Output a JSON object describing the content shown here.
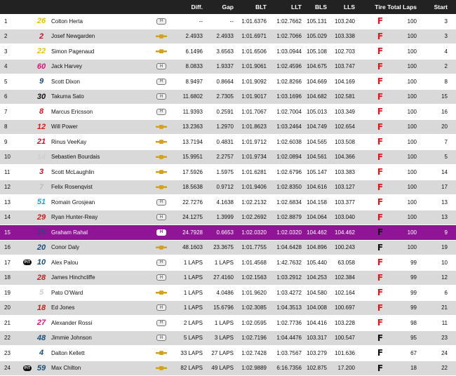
{
  "header": {
    "diff": "Diff.",
    "gap": "Gap",
    "blt": "BLT",
    "llt": "LLT",
    "bls": "BLS",
    "lls": "LLS",
    "tire": "Tire",
    "laps": "Total Laps",
    "start": "Start"
  },
  "colors": {
    "header_bg": "#222222",
    "row_even": "#d9d9d9",
    "highlight": "#8f1496",
    "tire_red": "#e8141c",
    "tire_black": "#111111"
  },
  "rows": [
    {
      "pos": "1",
      "pit": "",
      "num": "26",
      "num_color": "#e8c200",
      "name": "Colton Herta",
      "engine": "honda-icon",
      "diff": "--",
      "gap": "--",
      "blt": "1:01.6376",
      "llt": "1:02.7662",
      "bls": "105.131",
      "lls": "103.240",
      "tire": "red",
      "laps": "100",
      "start": "3"
    },
    {
      "pos": "2",
      "pit": "",
      "num": "2",
      "num_color": "#c8102e",
      "name": "Josef Newgarden",
      "engine": "chevrolet-icon",
      "diff": "2.4933",
      "gap": "2.4933",
      "blt": "1:01.6971",
      "llt": "1:02.7066",
      "bls": "105.029",
      "lls": "103.338",
      "tire": "red",
      "laps": "100",
      "start": "3"
    },
    {
      "pos": "3",
      "pit": "",
      "num": "22",
      "num_color": "#e8c200",
      "name": "Simon Pagenaud",
      "engine": "chevrolet-icon",
      "diff": "6.1496",
      "gap": "3.6563",
      "blt": "1:01.6506",
      "llt": "1:03.0944",
      "bls": "105.108",
      "lls": "102.703",
      "tire": "red",
      "laps": "100",
      "start": "4"
    },
    {
      "pos": "4",
      "pit": "",
      "num": "60",
      "num_color": "#e0127a",
      "name": "Jack Harvey",
      "engine": "honda-icon",
      "diff": "8.0833",
      "gap": "1.9337",
      "blt": "1:01.9061",
      "llt": "1:02.4596",
      "bls": "104.675",
      "lls": "103.747",
      "tire": "red",
      "laps": "100",
      "start": "2"
    },
    {
      "pos": "5",
      "pit": "",
      "num": "9",
      "num_color": "#1a4e7a",
      "name": "Scott Dixon",
      "engine": "honda-icon",
      "diff": "8.9497",
      "gap": "0.8664",
      "blt": "1:01.9092",
      "llt": "1:02.8266",
      "bls": "104.669",
      "lls": "104.169",
      "tire": "red",
      "laps": "100",
      "start": "8"
    },
    {
      "pos": "6",
      "pit": "",
      "num": "30",
      "num_color": "#111111",
      "name": "Takuma Sato",
      "engine": "honda-icon",
      "diff": "11.6802",
      "gap": "2.7305",
      "blt": "1:01.9017",
      "llt": "1:03.1696",
      "bls": "104.682",
      "lls": "102.581",
      "tire": "red",
      "laps": "100",
      "start": "15"
    },
    {
      "pos": "7",
      "pit": "",
      "num": "8",
      "num_color": "#d21b1b",
      "name": "Marcus Ericsson",
      "engine": "honda-icon",
      "diff": "11.9393",
      "gap": "0.2591",
      "blt": "1:01.7067",
      "llt": "1:02.7004",
      "bls": "105.013",
      "lls": "103.349",
      "tire": "red",
      "laps": "100",
      "start": "16"
    },
    {
      "pos": "8",
      "pit": "",
      "num": "12",
      "num_color": "#d21b1b",
      "name": "Will Power",
      "engine": "chevrolet-icon",
      "diff": "13.2363",
      "gap": "1.2970",
      "blt": "1:01.8623",
      "llt": "1:03.2464",
      "bls": "104.749",
      "lls": "102.654",
      "tire": "red",
      "laps": "100",
      "start": "20"
    },
    {
      "pos": "9",
      "pit": "",
      "num": "21",
      "num_color": "#c8102e",
      "name": "Rinus VeeKay",
      "engine": "chevrolet-icon",
      "diff": "13.7194",
      "gap": "0.4831",
      "blt": "1:01.9712",
      "llt": "1:02.6038",
      "bls": "104.565",
      "lls": "103.508",
      "tire": "red",
      "laps": "100",
      "start": "7"
    },
    {
      "pos": "10",
      "pit": "",
      "num": "14",
      "num_color": "#cfcfcf",
      "name": "Sebastien Bourdais",
      "engine": "chevrolet-icon",
      "diff": "15.9951",
      "gap": "2.2757",
      "blt": "1:01.9734",
      "llt": "1:02.0894",
      "bls": "104.561",
      "lls": "104.366",
      "tire": "red",
      "laps": "100",
      "start": "5"
    },
    {
      "pos": "11",
      "pit": "",
      "num": "3",
      "num_color": "#c8102e",
      "name": "Scott McLaughlin",
      "engine": "chevrolet-icon",
      "diff": "17.5926",
      "gap": "1.5975",
      "blt": "1:01.6281",
      "llt": "1:02.6796",
      "bls": "105.147",
      "lls": "103.383",
      "tire": "red",
      "laps": "100",
      "start": "14"
    },
    {
      "pos": "12",
      "pit": "",
      "num": "7",
      "num_color": "#bdbdbd",
      "name": "Felix Rosenqvist",
      "engine": "chevrolet-icon",
      "diff": "18.5638",
      "gap": "0.9712",
      "blt": "1:01.9406",
      "llt": "1:02.8350",
      "bls": "104.616",
      "lls": "103.127",
      "tire": "red",
      "laps": "100",
      "start": "17"
    },
    {
      "pos": "13",
      "pit": "",
      "num": "51",
      "num_color": "#1aa7d0",
      "name": "Romain Grosjean",
      "engine": "honda-icon",
      "diff": "22.7276",
      "gap": "4.1638",
      "blt": "1:02.2132",
      "llt": "1:02.6834",
      "bls": "104.158",
      "lls": "103.377",
      "tire": "red",
      "laps": "100",
      "start": "13"
    },
    {
      "pos": "14",
      "pit": "",
      "num": "29",
      "num_color": "#d21b1b",
      "name": "Ryan Hunter-Reay",
      "engine": "honda-icon",
      "diff": "24.1275",
      "gap": "1.3999",
      "blt": "1:02.2692",
      "llt": "1:02.8879",
      "bls": "104.064",
      "lls": "103.040",
      "tire": "red",
      "laps": "100",
      "start": "13"
    },
    {
      "pos": "15",
      "pit": "",
      "num": "15",
      "num_color": "#1a4e7a",
      "name": "Graham Rahal",
      "engine": "honda-icon",
      "diff": "24.7928",
      "gap": "0.6653",
      "blt": "1:02.0320",
      "llt": "1:02.0320",
      "bls": "104.462",
      "lls": "104.462",
      "tire": "black",
      "laps": "100",
      "start": "9",
      "highlight": true
    },
    {
      "pos": "16",
      "pit": "",
      "num": "20",
      "num_color": "#1a4e7a",
      "name": "Conor Daly",
      "engine": "chevrolet-icon",
      "diff": "48.1603",
      "gap": "23.3675",
      "blt": "1:01.7755",
      "llt": "1:04.6428",
      "bls": "104.896",
      "lls": "100.243",
      "tire": "black",
      "laps": "100",
      "start": "19"
    },
    {
      "pos": "17",
      "pit": "PIT",
      "num": "10",
      "num_color": "#1a4e7a",
      "name": "Alex Palou",
      "engine": "honda-icon",
      "diff": "1 LAPS",
      "gap": "1 LAPS",
      "blt": "1:01.4568",
      "llt": "1:42.7632",
      "bls": "105.440",
      "lls": "63.058",
      "tire": "red",
      "laps": "99",
      "start": "10"
    },
    {
      "pos": "18",
      "pit": "",
      "num": "28",
      "num_color": "#d21b1b",
      "name": "James Hinchcliffe",
      "engine": "honda-icon",
      "diff": "1 LAPS",
      "gap": "27.4160",
      "blt": "1:02.1563",
      "llt": "1:03.2912",
      "bls": "104.253",
      "lls": "102.384",
      "tire": "red",
      "laps": "99",
      "start": "12"
    },
    {
      "pos": "19",
      "pit": "",
      "num": "5",
      "num_color": "#cfcfcf",
      "name": "Pato O'Ward",
      "engine": "chevrolet-icon",
      "diff": "1 LAPS",
      "gap": "4.0486",
      "blt": "1:01.9620",
      "llt": "1:03.4272",
      "bls": "104.580",
      "lls": "102.164",
      "tire": "red",
      "laps": "99",
      "start": "6"
    },
    {
      "pos": "20",
      "pit": "",
      "num": "18",
      "num_color": "#d21b1b",
      "name": "Ed Jones",
      "engine": "honda-icon",
      "diff": "1 LAPS",
      "gap": "15.6796",
      "blt": "1:02.3085",
      "llt": "1:04.3513",
      "bls": "104.008",
      "lls": "100.697",
      "tire": "red",
      "laps": "99",
      "start": "21"
    },
    {
      "pos": "21",
      "pit": "",
      "num": "27",
      "num_color": "#e0127a",
      "name": "Alexander Rossi",
      "engine": "honda-icon",
      "diff": "2 LAPS",
      "gap": "1 LAPS",
      "blt": "1:02.0595",
      "llt": "1:02.7736",
      "bls": "104.416",
      "lls": "103.228",
      "tire": "red",
      "laps": "98",
      "start": "11"
    },
    {
      "pos": "22",
      "pit": "",
      "num": "48",
      "num_color": "#1a4e7a",
      "name": "Jimmie Johnson",
      "engine": "honda-icon",
      "diff": "5 LAPS",
      "gap": "3 LAPS",
      "blt": "1:02.7196",
      "llt": "1:04.4476",
      "bls": "103.317",
      "lls": "100.547",
      "tire": "black",
      "laps": "95",
      "start": "23"
    },
    {
      "pos": "23",
      "pit": "",
      "num": "4",
      "num_color": "#1a4e7a",
      "name": "Dalton Kellett",
      "engine": "chevrolet-icon",
      "diff": "33 LAPS",
      "gap": "27 LAPS",
      "blt": "1:02.7428",
      "llt": "1:03.7567",
      "bls": "103.279",
      "lls": "101.636",
      "tire": "black",
      "laps": "67",
      "start": "24"
    },
    {
      "pos": "24",
      "pit": "PIT",
      "num": "59",
      "num_color": "#1a4e7a",
      "name": "Max Chilton",
      "engine": "chevrolet-icon",
      "diff": "82 LAPS",
      "gap": "49 LAPS",
      "blt": "1:02.9889",
      "llt": "6:16.7356",
      "bls": "102.875",
      "lls": "17.200",
      "tire": "black",
      "laps": "18",
      "start": "22"
    }
  ]
}
